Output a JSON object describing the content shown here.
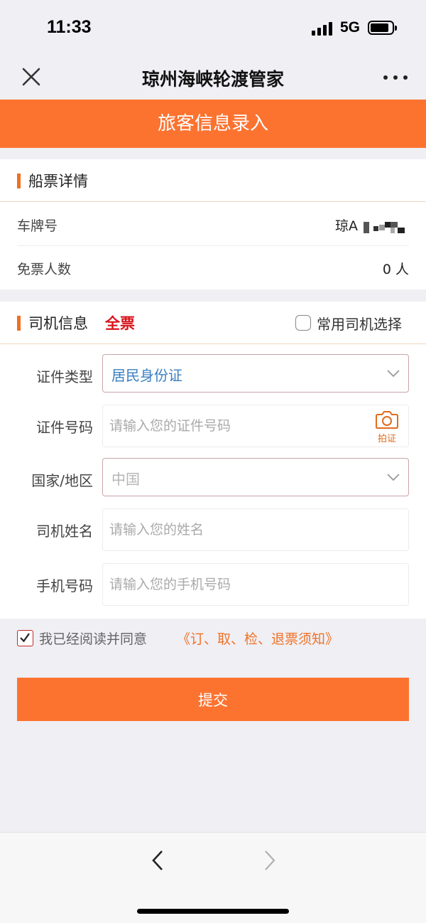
{
  "status_bar": {
    "time": "11:33",
    "network": "5G"
  },
  "nav": {
    "title": "琼州海峡轮渡管家"
  },
  "header": {
    "title": "旅客信息录入"
  },
  "ticket_section": {
    "title": "船票详情",
    "plate_label": "车牌号",
    "plate_value": "琼A",
    "free_label": "免票人数",
    "free_value": "0 人"
  },
  "driver_section": {
    "title": "司机信息",
    "ticket_type": "全票",
    "favorite_label": "常用司机选择"
  },
  "form": {
    "id_type_label": "证件类型",
    "id_type_value": "居民身份证",
    "id_number_label": "证件号码",
    "id_number_placeholder": "请输入您的证件号码",
    "camera_label": "拍证",
    "country_label": "国家/地区",
    "country_value": "中国",
    "name_label": "司机姓名",
    "name_placeholder": "请输入您的姓名",
    "phone_label": "手机号码",
    "phone_placeholder": "请输入您的手机号码"
  },
  "agreement": {
    "text": "我已经阅读并同意",
    "link": "《订、取、检、退票须知》"
  },
  "submit_label": "提交",
  "colors": {
    "accent": "#fc7330",
    "ticket_type": "#d8141c",
    "link": "#f07226",
    "select_value": "#3a7fc0"
  },
  "icons": [
    "close-icon",
    "more-icon",
    "chevron-down-icon",
    "camera-icon",
    "checkbox-icon",
    "back-icon",
    "forward-icon"
  ]
}
